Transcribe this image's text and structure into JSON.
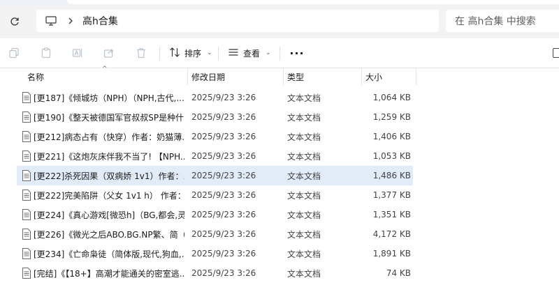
{
  "address": {
    "breadcrumb": "高h合集",
    "search_placeholder": "在 高h合集 中搜索"
  },
  "toolbar": {
    "sort_label": "排序",
    "view_label": "查看",
    "more_label": "···"
  },
  "columns": {
    "name": "名称",
    "date": "修改日期",
    "type": "类型",
    "size": "大小"
  },
  "files": [
    {
      "name": "[更187]《倾城坊（NPH）（NPH,古代,...",
      "date": "2025/9/23 3:26",
      "type": "文本文档",
      "size": "1,064 KB",
      "selected": false
    },
    {
      "name": "[更190]《整天被德国军官叔叔SP是种什...",
      "date": "2025/9/23 3:26",
      "type": "文本文档",
      "size": "1,259 KB",
      "selected": false
    },
    {
      "name": "[更212]病态占有（快穿）作者：奶猫薄...",
      "date": "2025/9/23 3:26",
      "type": "文本文档",
      "size": "1,406 KB",
      "selected": false
    },
    {
      "name": "[更221]《这炮灰床伴我不当了! 【NPH...",
      "date": "2025/9/23 3:26",
      "type": "文本文档",
      "size": "1,053 KB",
      "selected": false
    },
    {
      "name": "[更222]杀死因果（双病娇 1v1）作者：...",
      "date": "2025/9/23 3:26",
      "type": "文本文档",
      "size": "1,486 KB",
      "selected": true
    },
    {
      "name": "[更222]完美陷阱（父女 1v1 h） 作者：...",
      "date": "2025/9/23 3:26",
      "type": "文本文档",
      "size": "1,377 KB",
      "selected": false
    },
    {
      "name": "[更224]《真心游戏[微恐h]（BG,都会,灵...",
      "date": "2025/9/23 3:26",
      "type": "文本文档",
      "size": "1,351 KB",
      "selected": false
    },
    {
      "name": "[更226]《微光之后ABO.BG.NP繁、简（...",
      "date": "2025/9/23 3:26",
      "type": "文本文档",
      "size": "4,172 KB",
      "selected": false
    },
    {
      "name": "[更234]《亡命枭徒（简体版,现代,狗血,...",
      "date": "2025/9/23 3:26",
      "type": "文本文档",
      "size": "1,891 KB",
      "selected": false
    },
    {
      "name": "[完结]《【18+】高潮才能通关的密室逃...",
      "date": "2025/9/23 3:26",
      "type": "文本文档",
      "size": "74 KB",
      "selected": false
    }
  ]
}
